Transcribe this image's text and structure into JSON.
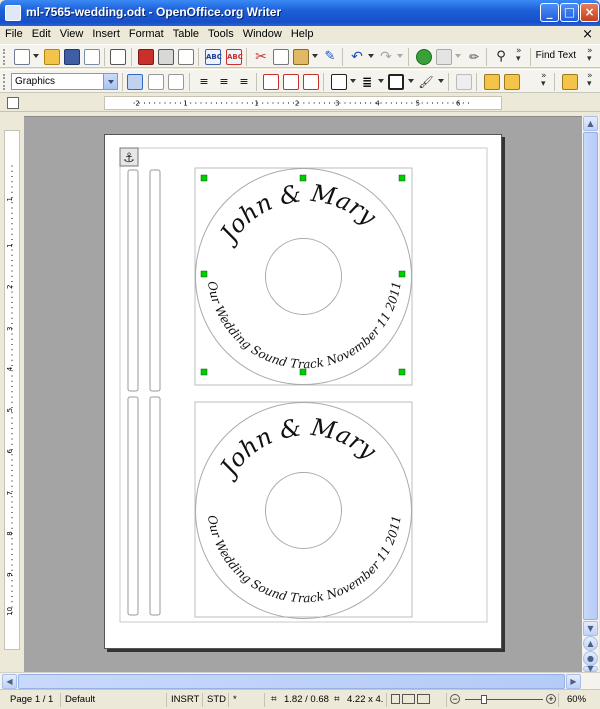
{
  "window": {
    "title": "ml-7565-wedding.odt - OpenOffice.org Writer"
  },
  "menubar": {
    "items": [
      "File",
      "Edit",
      "View",
      "Insert",
      "Format",
      "Table",
      "Tools",
      "Window",
      "Help"
    ]
  },
  "toolbar": {
    "find_label": "Find Text"
  },
  "format_toolbar": {
    "paragraph_style": "Graphics"
  },
  "ruler": {
    "h_labels": [
      "2",
      "1",
      "1",
      "2",
      "3",
      "4",
      "5",
      "6"
    ],
    "v_labels": [
      "1",
      "1",
      "2",
      "3",
      "4",
      "5",
      "6",
      "7",
      "8",
      "9",
      "10"
    ]
  },
  "document": {
    "labels": [
      {
        "top_text": "John & Mary",
        "bottom_text": "Our Wedding Sound Track November 11 2011"
      },
      {
        "top_text": "John & Mary",
        "bottom_text": "Our Wedding Sound Track November 11 2011"
      }
    ]
  },
  "statusbar": {
    "page": "Page 1 / 1",
    "style": "Default",
    "insert_mode": "INSRT",
    "selection_mode": "STD",
    "modified": "*",
    "position": "1.82 / 0.68",
    "size": "4.22 x 4.",
    "zoom": "60%"
  },
  "colors": {
    "titlebar": "#1c5fd8",
    "handle": "#00cc00",
    "page": "#ffffff",
    "workspace": "#a4a4a4"
  }
}
